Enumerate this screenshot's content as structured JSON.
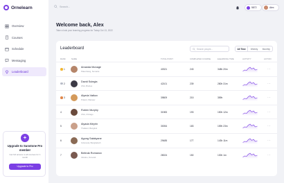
{
  "app": {
    "name": "Ornelearn"
  },
  "colors": {
    "accent": "#7b3fe4",
    "gold": "#f2b632",
    "silver": "#b8bcc8",
    "bronze": "#e0874b"
  },
  "sidebar": {
    "items": [
      {
        "label": "Overview",
        "icon": "grid-icon",
        "active": false
      },
      {
        "label": "Courses",
        "icon": "book-icon",
        "active": false
      },
      {
        "label": "Schedule",
        "icon": "calendar-icon",
        "active": false
      },
      {
        "label": "Messaging",
        "icon": "chat-icon",
        "active": false
      },
      {
        "label": "Leaderboard",
        "icon": "diamond-icon",
        "active": true
      }
    ],
    "upgrade": {
      "badge": "+",
      "title": "Upgrade to Sunstone Pro member",
      "description": "Get full access to all courses for 1 month",
      "button": "Upgrade to Pro"
    }
  },
  "topbar": {
    "search_placeholder": "Search...",
    "points": "5872",
    "user": "Alex"
  },
  "welcome": {
    "title": "Welcome back, Alex",
    "subtitle": "Take a look your learning progress for Today Oct 13, 2022"
  },
  "leaderboard": {
    "title": "Leaderboard",
    "search_placeholder": "Search people...",
    "filters": [
      "All Time",
      "Weekly",
      "Monthly"
    ],
    "columns": [
      "RANK",
      "NAME",
      "TOTAL POINT",
      "COMPLETED COURSE",
      "ELEARNING TIME",
      "ACTIVITY",
      "ACTION"
    ],
    "rows": [
      {
        "rank": "1",
        "medal": "gold",
        "name": "Amanda Monage",
        "location": "Palembang, Sumatra",
        "points": "40321",
        "courses": "243",
        "time": "348h 20m",
        "avatar_color": "#b5856a"
      },
      {
        "rank": "2",
        "medal": "silver",
        "name": "David Sulegia",
        "location": "USA, Brebes",
        "points": "42101",
        "courses": "239",
        "time": "280h 31m",
        "avatar_color": "#3c3a45"
      },
      {
        "rank": "3",
        "medal": "bronze",
        "name": "Alyeda Vatkov",
        "location": "Poland, Warsaw",
        "points": "39809",
        "courses": "215",
        "time": "359h",
        "avatar_color": "#d49a5b"
      },
      {
        "rank": "4",
        "medal": "",
        "name": "Ruben Murphy",
        "location": "USA, Chicago",
        "points": "31983",
        "courses": "193",
        "time": "150h 12m",
        "avatar_color": "#6a4a3c"
      },
      {
        "rank": "5",
        "medal": "",
        "name": "Alyada Meyrin",
        "location": "Thailand, Bangkok",
        "points": "30054",
        "courses": "183",
        "time": "159h 23m",
        "avatar_color": "#caa08a"
      },
      {
        "rank": "6",
        "medal": "",
        "name": "Agung Salakyane",
        "location": "Indonesia, Bangladesh",
        "points": "29485",
        "courses": "177",
        "time": "143h 11m",
        "avatar_color": "#8a6a55"
      },
      {
        "rank": "7",
        "medal": "",
        "name": "Belinda Romanov",
        "location": "Ukraine, Donetsk",
        "points": "28024",
        "courses": "150",
        "time": "130h 1m",
        "avatar_color": "#7a5a50"
      }
    ]
  }
}
